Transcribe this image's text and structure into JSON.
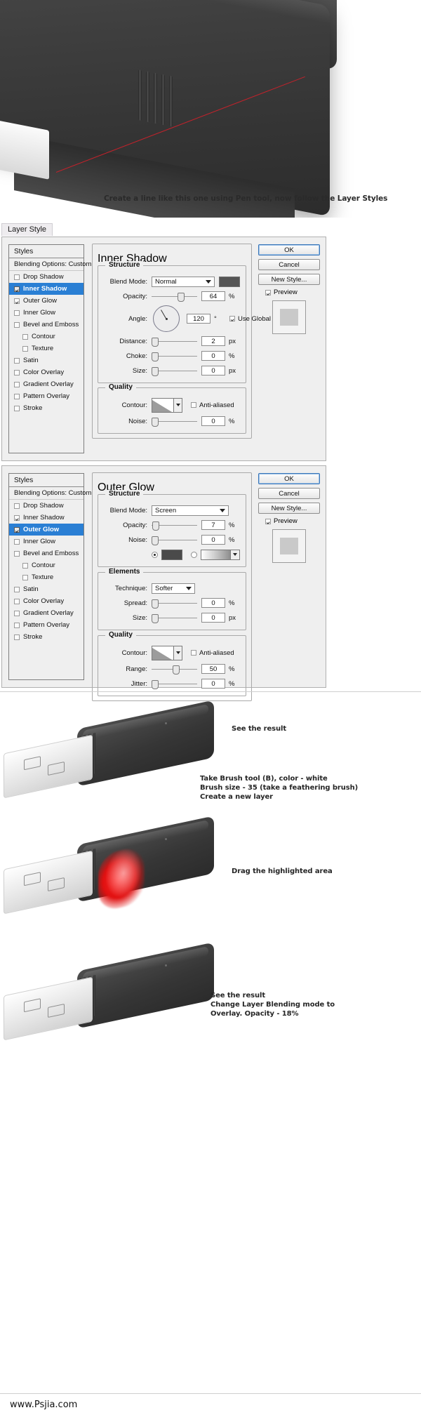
{
  "hero": {
    "caption": "Create a line like this one using Pen tool, now follow the Layer Styles"
  },
  "layer_style_tab": "Layer Style",
  "dialogs": [
    {
      "id": "inner-shadow",
      "styles_header": "Styles",
      "blending_options": "Blending Options: Custom",
      "style_items": [
        {
          "label": "Drop Shadow",
          "checked": false,
          "selected": false,
          "sub": false
        },
        {
          "label": "Inner Shadow",
          "checked": true,
          "selected": true,
          "sub": false
        },
        {
          "label": "Outer Glow",
          "checked": true,
          "selected": false,
          "sub": false
        },
        {
          "label": "Inner Glow",
          "checked": false,
          "selected": false,
          "sub": false
        },
        {
          "label": "Bevel and Emboss",
          "checked": false,
          "selected": false,
          "sub": false
        },
        {
          "label": "Contour",
          "checked": false,
          "selected": false,
          "sub": true
        },
        {
          "label": "Texture",
          "checked": false,
          "selected": false,
          "sub": true
        },
        {
          "label": "Satin",
          "checked": false,
          "selected": false,
          "sub": false
        },
        {
          "label": "Color Overlay",
          "checked": false,
          "selected": false,
          "sub": false
        },
        {
          "label": "Gradient Overlay",
          "checked": false,
          "selected": false,
          "sub": false
        },
        {
          "label": "Pattern Overlay",
          "checked": false,
          "selected": false,
          "sub": false
        },
        {
          "label": "Stroke",
          "checked": false,
          "selected": false,
          "sub": false
        }
      ],
      "panel_title": "Inner Shadow",
      "structure_title": "Structure",
      "quality_title": "Quality",
      "blend_mode_label": "Blend Mode:",
      "blend_mode_value": "Normal",
      "blend_color": "#555555",
      "opacity_label": "Opacity:",
      "opacity_value": "64",
      "opacity_unit": "%",
      "angle_label": "Angle:",
      "angle_value": "120",
      "angle_unit": "°",
      "use_global_light": "Use Global Light",
      "use_global_light_checked": true,
      "distance_label": "Distance:",
      "distance_value": "2",
      "distance_unit": "px",
      "choke_label": "Choke:",
      "choke_value": "0",
      "choke_unit": "%",
      "size_label": "Size:",
      "size_value": "0",
      "size_unit": "px",
      "contour_label": "Contour:",
      "anti_aliased": "Anti-aliased",
      "anti_aliased_checked": false,
      "noise_label": "Noise:",
      "noise_value": "0",
      "noise_unit": "%",
      "buttons": {
        "ok": "OK",
        "cancel": "Cancel",
        "new_style": "New Style...",
        "preview": "Preview",
        "preview_checked": true
      }
    },
    {
      "id": "outer-glow",
      "styles_header": "Styles",
      "blending_options": "Blending Options: Custom",
      "style_items": [
        {
          "label": "Drop Shadow",
          "checked": false,
          "selected": false,
          "sub": false
        },
        {
          "label": "Inner Shadow",
          "checked": true,
          "selected": false,
          "sub": false
        },
        {
          "label": "Outer Glow",
          "checked": true,
          "selected": true,
          "sub": false
        },
        {
          "label": "Inner Glow",
          "checked": false,
          "selected": false,
          "sub": false
        },
        {
          "label": "Bevel and Emboss",
          "checked": false,
          "selected": false,
          "sub": false
        },
        {
          "label": "Contour",
          "checked": false,
          "selected": false,
          "sub": true
        },
        {
          "label": "Texture",
          "checked": false,
          "selected": false,
          "sub": true
        },
        {
          "label": "Satin",
          "checked": false,
          "selected": false,
          "sub": false
        },
        {
          "label": "Color Overlay",
          "checked": false,
          "selected": false,
          "sub": false
        },
        {
          "label": "Gradient Overlay",
          "checked": false,
          "selected": false,
          "sub": false
        },
        {
          "label": "Pattern Overlay",
          "checked": false,
          "selected": false,
          "sub": false
        },
        {
          "label": "Stroke",
          "checked": false,
          "selected": false,
          "sub": false
        }
      ],
      "panel_title": "Outer Glow",
      "structure_title": "Structure",
      "elements_title": "Elements",
      "quality_title": "Quality",
      "blend_mode_label": "Blend Mode:",
      "blend_mode_value": "Screen",
      "opacity_label": "Opacity:",
      "opacity_value": "7",
      "opacity_unit": "%",
      "noise_label": "Noise:",
      "noise_value": "0",
      "noise_unit": "%",
      "glow_color": "#4a4a4a",
      "technique_label": "Technique:",
      "technique_value": "Softer",
      "spread_label": "Spread:",
      "spread_value": "0",
      "spread_unit": "%",
      "size_label": "Size:",
      "size_value": "0",
      "size_unit": "px",
      "contour_label": "Contour:",
      "anti_aliased": "Anti-aliased",
      "anti_aliased_checked": false,
      "range_label": "Range:",
      "range_value": "50",
      "range_unit": "%",
      "jitter_label": "Jitter:",
      "jitter_value": "0",
      "jitter_unit": "%",
      "buttons": {
        "ok": "OK",
        "cancel": "Cancel",
        "new_style": "New Style...",
        "preview": "Preview",
        "preview_checked": true
      }
    }
  ],
  "results": [
    {
      "note": "See the result"
    },
    {
      "note": "Take Brush tool (B), color - white\nBrush size - 35 (take a feathering brush)\nCreate a new layer"
    },
    {
      "note": "Drag the highlighted area"
    },
    {
      "note": "See the result\nChange Layer Blending mode to\nOverlay. Opacity - 18%"
    }
  ],
  "footer": {
    "url": "www.Psjia.com"
  }
}
